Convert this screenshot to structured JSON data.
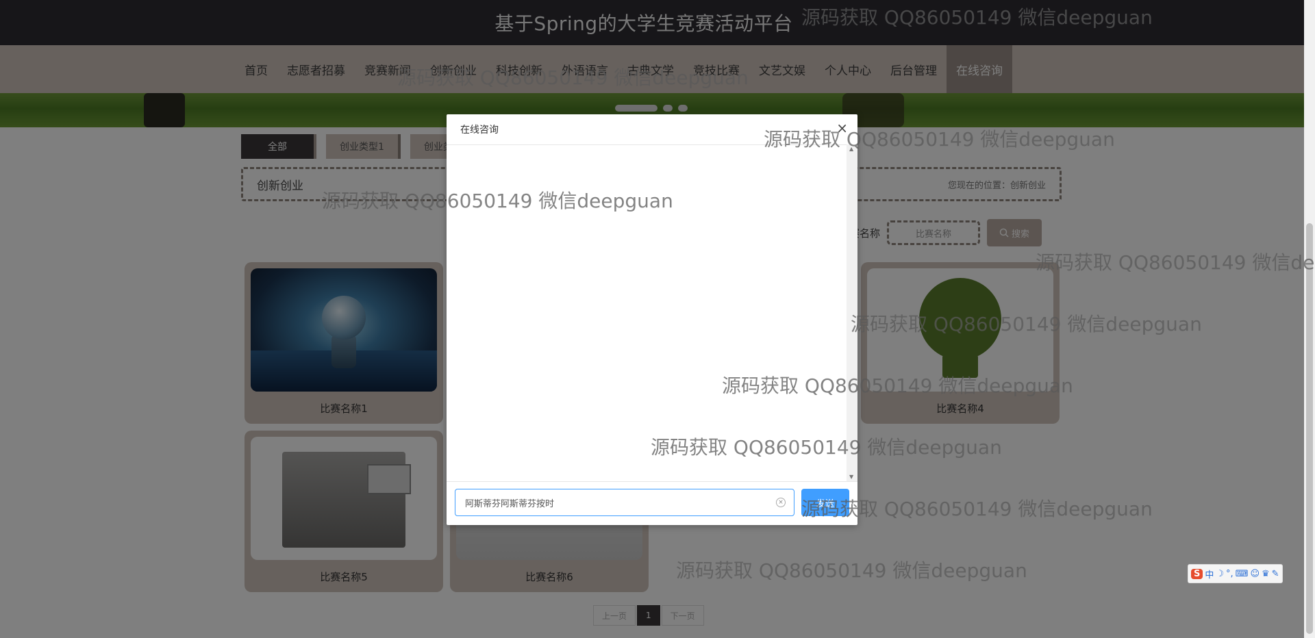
{
  "site_title": "基于Spring的大学生竞赛活动平台",
  "nav": {
    "items": [
      "首页",
      "志愿者招募",
      "竞赛新闻",
      "创新创业",
      "科技创新",
      "外语语言",
      "古典文学",
      "竞技比赛",
      "文艺文娱",
      "个人中心",
      "后台管理",
      "在线咨询"
    ],
    "active": "在线咨询"
  },
  "category_tabs": [
    "全部",
    "创业类型1",
    "创业类"
  ],
  "breadcrumb": {
    "title": "创新创业",
    "location": "您现在的位置：创新创业"
  },
  "search": {
    "label": "赛名称",
    "placeholder": "比赛名称",
    "button": "搜索"
  },
  "cards": [
    {
      "name": "比赛名称1"
    },
    {
      "name": "比赛名称4"
    },
    {
      "name": "比赛名称5"
    },
    {
      "name": "比赛名称6"
    }
  ],
  "pagination": {
    "prev": "上一页",
    "current": "1",
    "next": "下一页"
  },
  "modal": {
    "title": "在线咨询",
    "close_symbol": "×",
    "input_value": "阿斯蒂芬阿斯蒂芬按时",
    "send_label": "发送"
  },
  "watermark_text": "源码获取 QQ86050149 微信deepguan",
  "ime": {
    "logo": "S",
    "mode": "中",
    "icons": [
      "moon-icon",
      "punctuation-icon",
      "keyboard-icon",
      "user-icon",
      "shirt-icon",
      "wrench-icon"
    ]
  },
  "colors": {
    "topbar": "#2f2c33",
    "nav": "#cfc3bb",
    "nav_active": "#9a8f88",
    "accent": "#409eff"
  }
}
